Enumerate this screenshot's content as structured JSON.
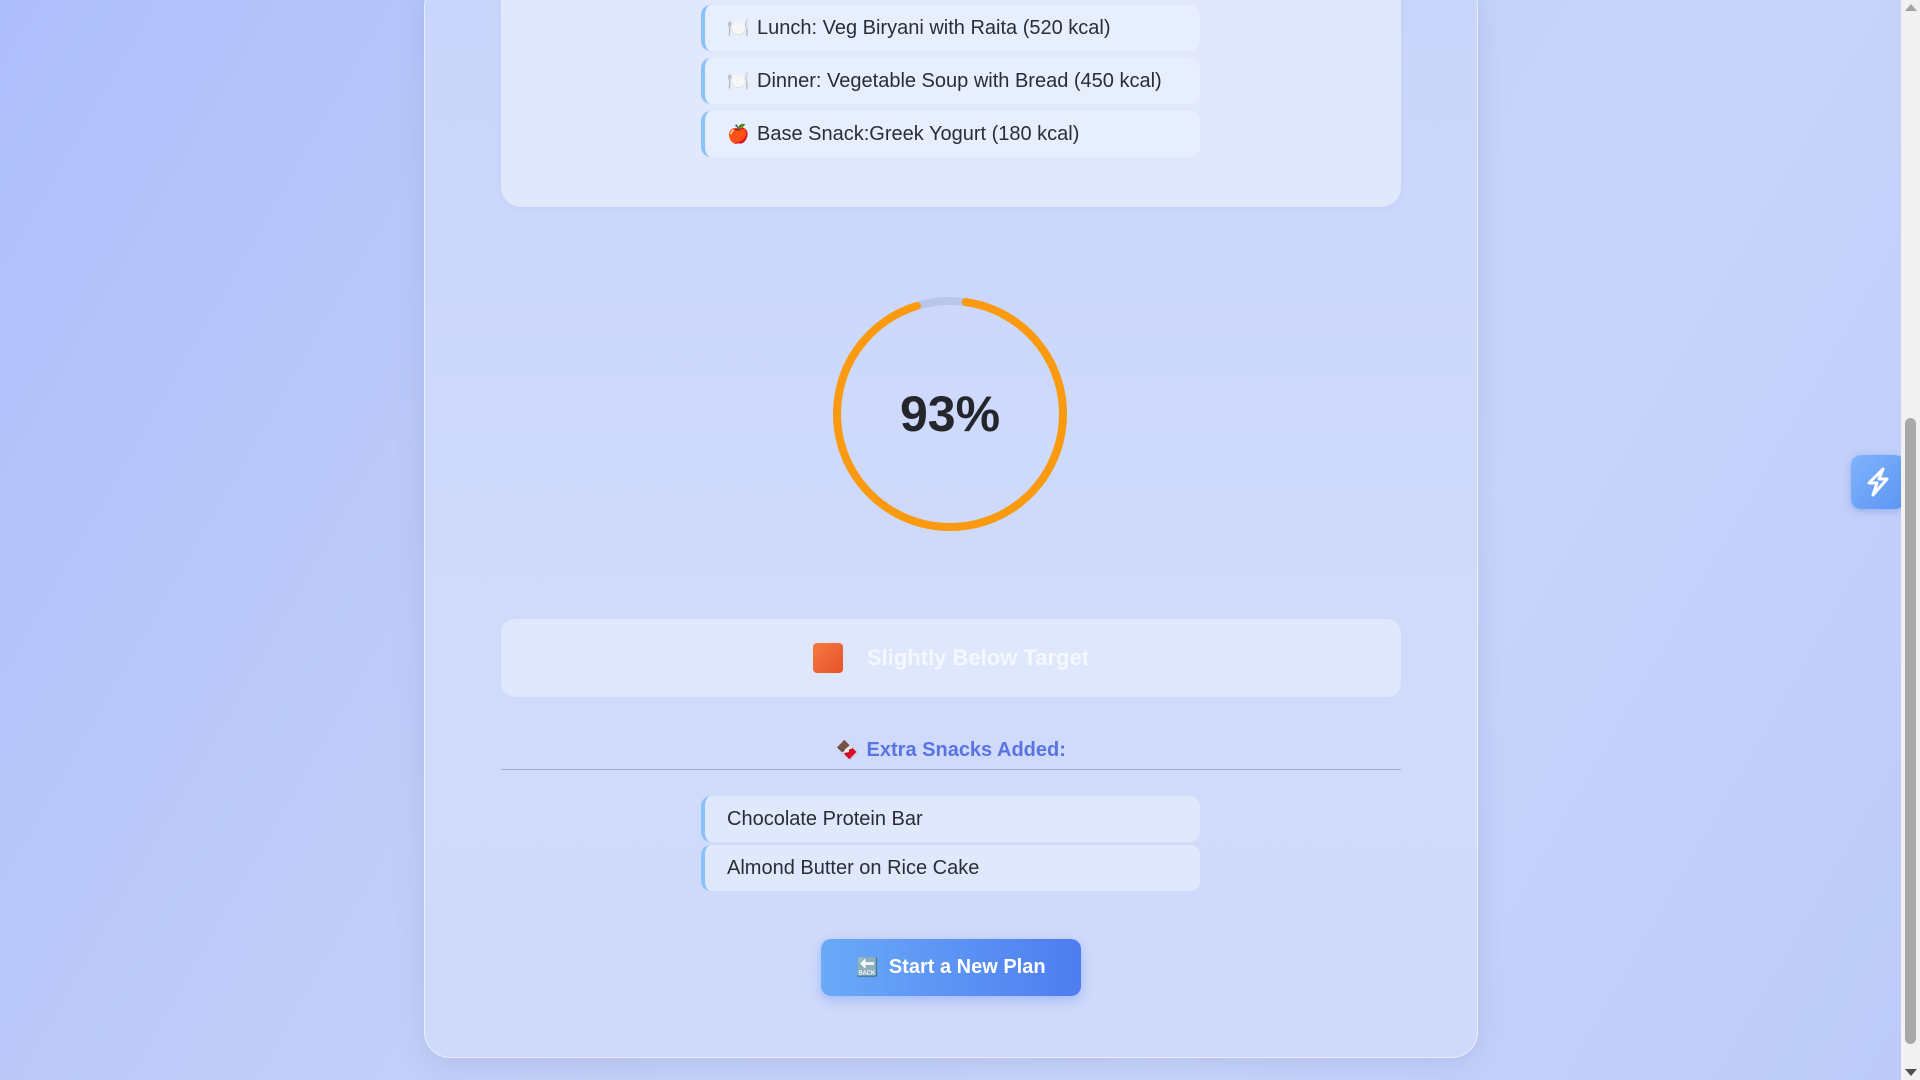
{
  "meals": {
    "items": [
      {
        "icon": "🍽️",
        "label": "Lunch: Veg Biryani with Raita (520 kcal)"
      },
      {
        "icon": "🍽️",
        "label": "Dinner: Vegetable Soup with Bread (450 kcal)"
      },
      {
        "icon": "🍎",
        "label": "Base Snack:Greek Yogurt (180 kcal)"
      }
    ]
  },
  "progress": {
    "percent_label": "93%",
    "fraction": 0.93,
    "ring_color": "#fb9a0e",
    "track_color": "#b9c6e8"
  },
  "status": {
    "icon": "orange-square-icon",
    "text": "Slightly Below Target"
  },
  "extra_snacks": {
    "icon": "🍫",
    "heading": "Extra Snacks Added:",
    "items": [
      "Chocolate Protein Bar",
      "Almond Butter on Rice Cake"
    ]
  },
  "actions": {
    "new_plan_icon": "🔙",
    "new_plan_label": "Start a New Plan"
  },
  "colors": {
    "accent": "#5a73e3",
    "button": "#4e7df0"
  }
}
